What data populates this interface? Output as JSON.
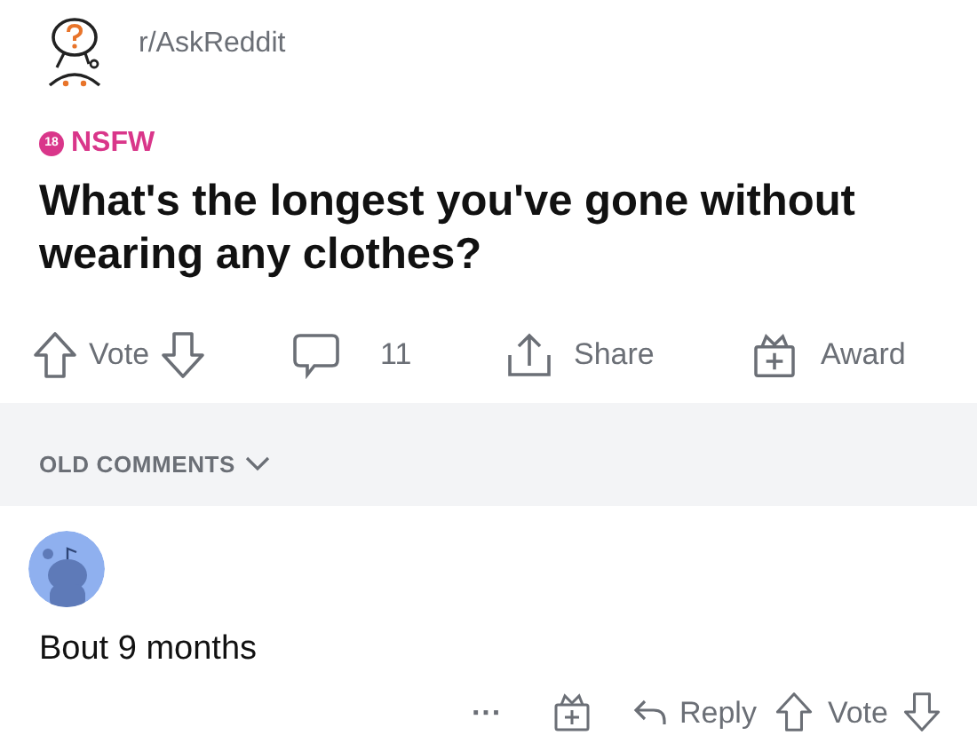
{
  "post": {
    "subreddit": "r/AskReddit",
    "nsfw_badge": "18",
    "flair": "NSFW",
    "title": "What's the longest you've gone without wearing any clothes?"
  },
  "post_actions": {
    "vote": "Vote",
    "comments": "11",
    "share": "Share",
    "award": "Award"
  },
  "sort": {
    "label": "OLD COMMENTS",
    "expanded": false
  },
  "comments": [
    {
      "text": "Bout 9 months",
      "more": "···",
      "reply": "Reply",
      "vote": "Vote"
    }
  ]
}
